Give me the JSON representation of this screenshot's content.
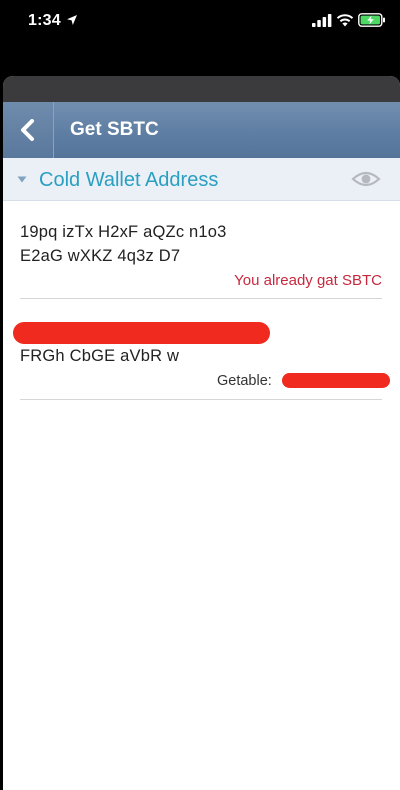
{
  "status_bar": {
    "time": "1:34",
    "icons": [
      "location-arrow-icon",
      "cellular-signal-icon",
      "wifi-icon",
      "battery-charging-icon"
    ],
    "battery_color": "#4cd964"
  },
  "nav": {
    "title": "Get SBTC",
    "back_icon": "chevron-left-icon",
    "bar_color": "#5e7ea3"
  },
  "section": {
    "title": "Cold Wallet Address",
    "toggle_icon": "chevron-down-icon",
    "visibility_icon": "eye-icon",
    "accent": "#2a9fc2"
  },
  "entries": [
    {
      "address_line_1": "19pq izTx H2xF aQZc n1o3",
      "address_line_2": "E2aG wXKZ 4q3z D7",
      "status": "You already gat SBTC",
      "status_color": "#c8283e"
    },
    {
      "address_line_1": "FRGh CbGE aVbR w",
      "getable_label": "Getable:"
    }
  ],
  "colors": {
    "redaction": "#f02a1e"
  }
}
